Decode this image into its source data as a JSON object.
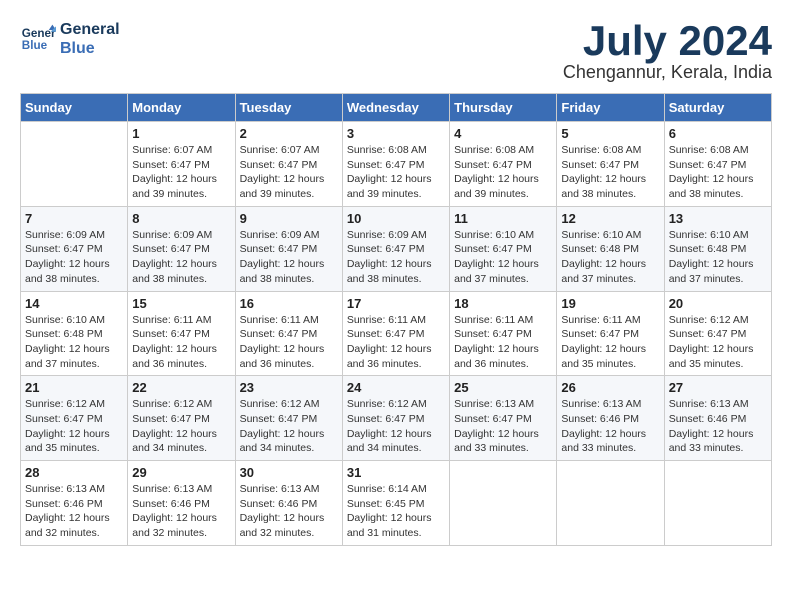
{
  "header": {
    "logo_line1": "General",
    "logo_line2": "Blue",
    "month": "July 2024",
    "location": "Chengannur, Kerala, India"
  },
  "weekdays": [
    "Sunday",
    "Monday",
    "Tuesday",
    "Wednesday",
    "Thursday",
    "Friday",
    "Saturday"
  ],
  "weeks": [
    [
      {
        "day": "",
        "info": ""
      },
      {
        "day": "1",
        "info": "Sunrise: 6:07 AM\nSunset: 6:47 PM\nDaylight: 12 hours\nand 39 minutes."
      },
      {
        "day": "2",
        "info": "Sunrise: 6:07 AM\nSunset: 6:47 PM\nDaylight: 12 hours\nand 39 minutes."
      },
      {
        "day": "3",
        "info": "Sunrise: 6:08 AM\nSunset: 6:47 PM\nDaylight: 12 hours\nand 39 minutes."
      },
      {
        "day": "4",
        "info": "Sunrise: 6:08 AM\nSunset: 6:47 PM\nDaylight: 12 hours\nand 39 minutes."
      },
      {
        "day": "5",
        "info": "Sunrise: 6:08 AM\nSunset: 6:47 PM\nDaylight: 12 hours\nand 38 minutes."
      },
      {
        "day": "6",
        "info": "Sunrise: 6:08 AM\nSunset: 6:47 PM\nDaylight: 12 hours\nand 38 minutes."
      }
    ],
    [
      {
        "day": "7",
        "info": "Sunrise: 6:09 AM\nSunset: 6:47 PM\nDaylight: 12 hours\nand 38 minutes."
      },
      {
        "day": "8",
        "info": "Sunrise: 6:09 AM\nSunset: 6:47 PM\nDaylight: 12 hours\nand 38 minutes."
      },
      {
        "day": "9",
        "info": "Sunrise: 6:09 AM\nSunset: 6:47 PM\nDaylight: 12 hours\nand 38 minutes."
      },
      {
        "day": "10",
        "info": "Sunrise: 6:09 AM\nSunset: 6:47 PM\nDaylight: 12 hours\nand 38 minutes."
      },
      {
        "day": "11",
        "info": "Sunrise: 6:10 AM\nSunset: 6:47 PM\nDaylight: 12 hours\nand 37 minutes."
      },
      {
        "day": "12",
        "info": "Sunrise: 6:10 AM\nSunset: 6:48 PM\nDaylight: 12 hours\nand 37 minutes."
      },
      {
        "day": "13",
        "info": "Sunrise: 6:10 AM\nSunset: 6:48 PM\nDaylight: 12 hours\nand 37 minutes."
      }
    ],
    [
      {
        "day": "14",
        "info": "Sunrise: 6:10 AM\nSunset: 6:48 PM\nDaylight: 12 hours\nand 37 minutes."
      },
      {
        "day": "15",
        "info": "Sunrise: 6:11 AM\nSunset: 6:47 PM\nDaylight: 12 hours\nand 36 minutes."
      },
      {
        "day": "16",
        "info": "Sunrise: 6:11 AM\nSunset: 6:47 PM\nDaylight: 12 hours\nand 36 minutes."
      },
      {
        "day": "17",
        "info": "Sunrise: 6:11 AM\nSunset: 6:47 PM\nDaylight: 12 hours\nand 36 minutes."
      },
      {
        "day": "18",
        "info": "Sunrise: 6:11 AM\nSunset: 6:47 PM\nDaylight: 12 hours\nand 36 minutes."
      },
      {
        "day": "19",
        "info": "Sunrise: 6:11 AM\nSunset: 6:47 PM\nDaylight: 12 hours\nand 35 minutes."
      },
      {
        "day": "20",
        "info": "Sunrise: 6:12 AM\nSunset: 6:47 PM\nDaylight: 12 hours\nand 35 minutes."
      }
    ],
    [
      {
        "day": "21",
        "info": "Sunrise: 6:12 AM\nSunset: 6:47 PM\nDaylight: 12 hours\nand 35 minutes."
      },
      {
        "day": "22",
        "info": "Sunrise: 6:12 AM\nSunset: 6:47 PM\nDaylight: 12 hours\nand 34 minutes."
      },
      {
        "day": "23",
        "info": "Sunrise: 6:12 AM\nSunset: 6:47 PM\nDaylight: 12 hours\nand 34 minutes."
      },
      {
        "day": "24",
        "info": "Sunrise: 6:12 AM\nSunset: 6:47 PM\nDaylight: 12 hours\nand 34 minutes."
      },
      {
        "day": "25",
        "info": "Sunrise: 6:13 AM\nSunset: 6:47 PM\nDaylight: 12 hours\nand 33 minutes."
      },
      {
        "day": "26",
        "info": "Sunrise: 6:13 AM\nSunset: 6:46 PM\nDaylight: 12 hours\nand 33 minutes."
      },
      {
        "day": "27",
        "info": "Sunrise: 6:13 AM\nSunset: 6:46 PM\nDaylight: 12 hours\nand 33 minutes."
      }
    ],
    [
      {
        "day": "28",
        "info": "Sunrise: 6:13 AM\nSunset: 6:46 PM\nDaylight: 12 hours\nand 32 minutes."
      },
      {
        "day": "29",
        "info": "Sunrise: 6:13 AM\nSunset: 6:46 PM\nDaylight: 12 hours\nand 32 minutes."
      },
      {
        "day": "30",
        "info": "Sunrise: 6:13 AM\nSunset: 6:46 PM\nDaylight: 12 hours\nand 32 minutes."
      },
      {
        "day": "31",
        "info": "Sunrise: 6:14 AM\nSunset: 6:45 PM\nDaylight: 12 hours\nand 31 minutes."
      },
      {
        "day": "",
        "info": ""
      },
      {
        "day": "",
        "info": ""
      },
      {
        "day": "",
        "info": ""
      }
    ]
  ]
}
